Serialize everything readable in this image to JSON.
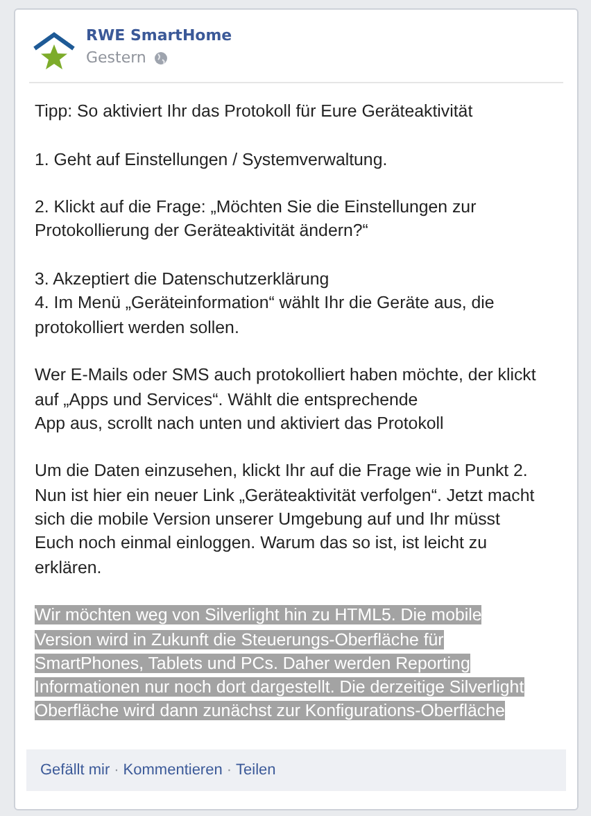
{
  "post": {
    "author": "RWE SmartHome",
    "time": "Gestern",
    "paragraphs": [
      {
        "highlighted": false,
        "lines": [
          "Tipp: So aktiviert Ihr das Protokoll für Eure Geräteaktivität"
        ]
      },
      {
        "highlighted": false,
        "lines": [
          "1. Geht auf Einstellungen / Systemverwaltung."
        ]
      },
      {
        "highlighted": false,
        "lines": [
          "2. Klickt auf die Frage: „Möchten Sie die Einstellungen zur",
          "Protokollierung der Geräteaktivität ändern?“"
        ]
      },
      {
        "highlighted": false,
        "lines": [
          "3. Akzeptiert die Datenschutzerklärung",
          "4. Im Menü „Geräteinformation“ wählt Ihr die Geräte aus, die",
          "protokolliert werden sollen."
        ]
      },
      {
        "highlighted": false,
        "lines": [
          "Wer E-Mails oder SMS auch protokolliert haben möchte, der klickt",
          "auf „Apps und Services“. Wählt die entsprechende",
          "App aus, scrollt nach unten und aktiviert das Protokoll"
        ]
      },
      {
        "highlighted": false,
        "lines": [
          "Um die Daten einzusehen, klickt Ihr auf die Frage wie in Punkt 2.",
          "Nun ist hier ein neuer Link „Geräteaktivität verfolgen“. Jetzt macht",
          "sich die mobile Version unserer Umgebung auf und Ihr müsst",
          "Euch noch einmal einloggen. Warum das so ist, ist leicht zu",
          "erklären."
        ]
      },
      {
        "highlighted": true,
        "lines": [
          "Wir möchten weg von Silverlight hin zu HTML5. Die mobile",
          "Version wird in Zukunft die Steuerungs-Oberfläche für",
          "SmartPhones, Tablets und PCs. Daher werden Reporting",
          "Informationen nur noch dort dargestellt. Die derzeitige Silverlight",
          "Oberfläche wird dann zunächst zur Konfigurations-Oberfläche"
        ]
      }
    ],
    "separator": "·",
    "actions": [
      {
        "label": "Gefällt mir"
      },
      {
        "label": "Kommentieren"
      },
      {
        "label": "Teilen"
      }
    ]
  }
}
